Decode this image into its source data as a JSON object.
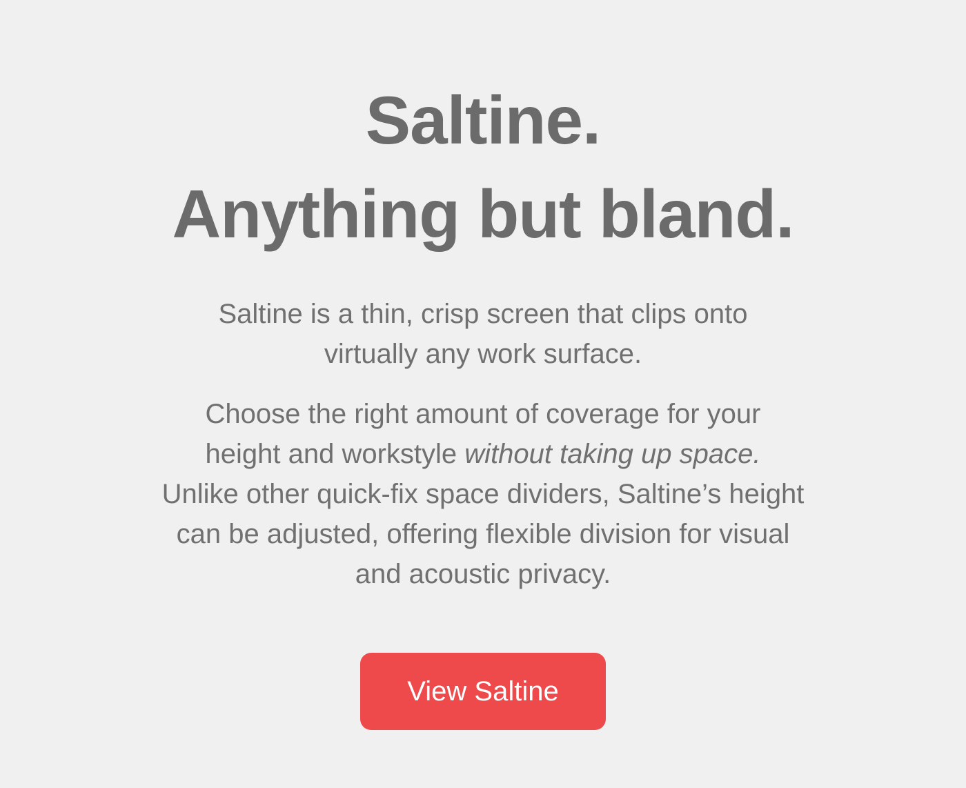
{
  "headline": {
    "line1": "Saltine.",
    "line2": "Anything but bland."
  },
  "intro": {
    "line1": "Saltine is a thin, crisp screen that clips onto",
    "line2": "virtually any work surface."
  },
  "body": {
    "line1": "Choose the right amount of coverage for your",
    "line2_plain": "height and workstyle ",
    "line2_italic": "without taking up space.",
    "line3": "Unlike other quick-fix space dividers, Saltine’s height",
    "line4": "can be adjusted, offering flexible division for visual",
    "line5": "and acoustic privacy."
  },
  "cta": {
    "label": "View Saltine"
  },
  "colors": {
    "background": "#f0f0f0",
    "text": "#6e6e6e",
    "accent": "#ee4a4c",
    "button_text": "#ffffff"
  }
}
